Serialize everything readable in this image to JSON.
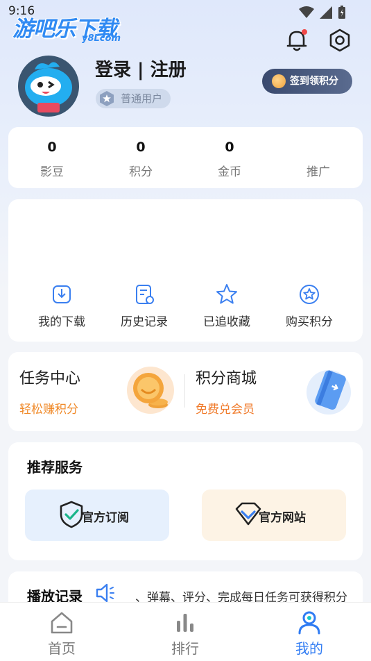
{
  "status_bar": {
    "time": "9:16"
  },
  "logo": {
    "title": "游吧乐下载",
    "subtitle": "y8Lcom"
  },
  "profile": {
    "login_text": "登录 | 注册",
    "user_level": "普通用户",
    "checkin_label": "签到领积分"
  },
  "stats": [
    {
      "value": "0",
      "label": "影豆"
    },
    {
      "value": "0",
      "label": "积分"
    },
    {
      "value": "0",
      "label": "金币"
    },
    {
      "value": "",
      "label": "推广"
    }
  ],
  "quick_actions": [
    {
      "label": "我的下载",
      "icon": "download-icon"
    },
    {
      "label": "历史记录",
      "icon": "history-icon"
    },
    {
      "label": "已追收藏",
      "icon": "star-icon"
    },
    {
      "label": "购买积分",
      "icon": "star-circle-icon"
    }
  ],
  "task_center": {
    "title": "任务中心",
    "subtitle": "轻松赚积分"
  },
  "points_mall": {
    "title": "积分商城",
    "subtitle": "免费兑会员"
  },
  "recommend": {
    "title": "推荐服务",
    "items": [
      {
        "label": "官方订阅",
        "icon": "shield-check-icon",
        "bg": "#e6f0fd"
      },
      {
        "label": "官方网站",
        "icon": "diamond-icon",
        "bg": "#fdf3e5"
      }
    ]
  },
  "play_record": {
    "title": "播放记录",
    "hint": "、弹幕、评分、完成每日任务可获得积分"
  },
  "bottom_nav": [
    {
      "label": "首页",
      "icon": "home-icon",
      "active": false
    },
    {
      "label": "排行",
      "icon": "rank-icon",
      "active": false
    },
    {
      "label": "我的",
      "icon": "user-icon",
      "active": true
    }
  ],
  "colors": {
    "accent": "#2f7bf3",
    "orange": "#f08a2a",
    "inactive": "#777777"
  }
}
